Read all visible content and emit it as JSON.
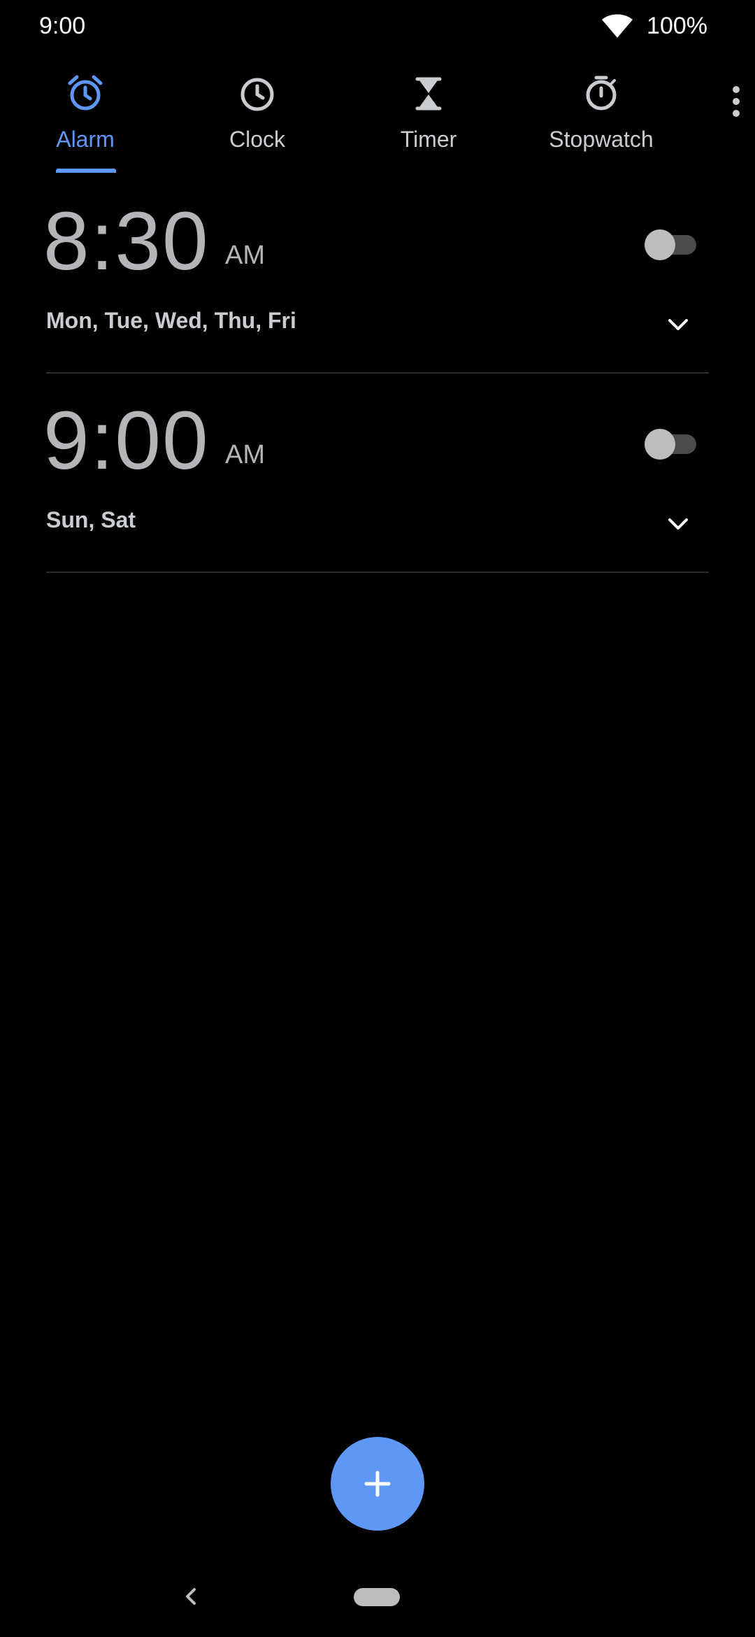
{
  "status_bar": {
    "time": "9:00",
    "battery": "100%",
    "icons": [
      "wifi-icon"
    ]
  },
  "tabs": [
    {
      "label": "Alarm",
      "icon": "alarm-icon",
      "active": true
    },
    {
      "label": "Clock",
      "icon": "clock-icon",
      "active": false
    },
    {
      "label": "Timer",
      "icon": "hourglass-icon",
      "active": false
    },
    {
      "label": "Stopwatch",
      "icon": "stopwatch-icon",
      "active": false
    }
  ],
  "overflow_menu_icon": "more-vert-icon",
  "alarms": [
    {
      "time": "8:30",
      "ampm": "AM",
      "days": "Mon, Tue, Wed, Thu, Fri",
      "enabled": false
    },
    {
      "time": "9:00",
      "ampm": "AM",
      "days": "Sun, Sat",
      "enabled": false
    }
  ],
  "fab": {
    "icon": "add-icon"
  },
  "nav": {
    "icons": [
      "back-icon",
      "home-pill"
    ]
  },
  "colors": {
    "accent": "#5e97f6",
    "background": "#000000",
    "text_secondary": "#b3b5b8",
    "divider": "#2b2c2e"
  }
}
